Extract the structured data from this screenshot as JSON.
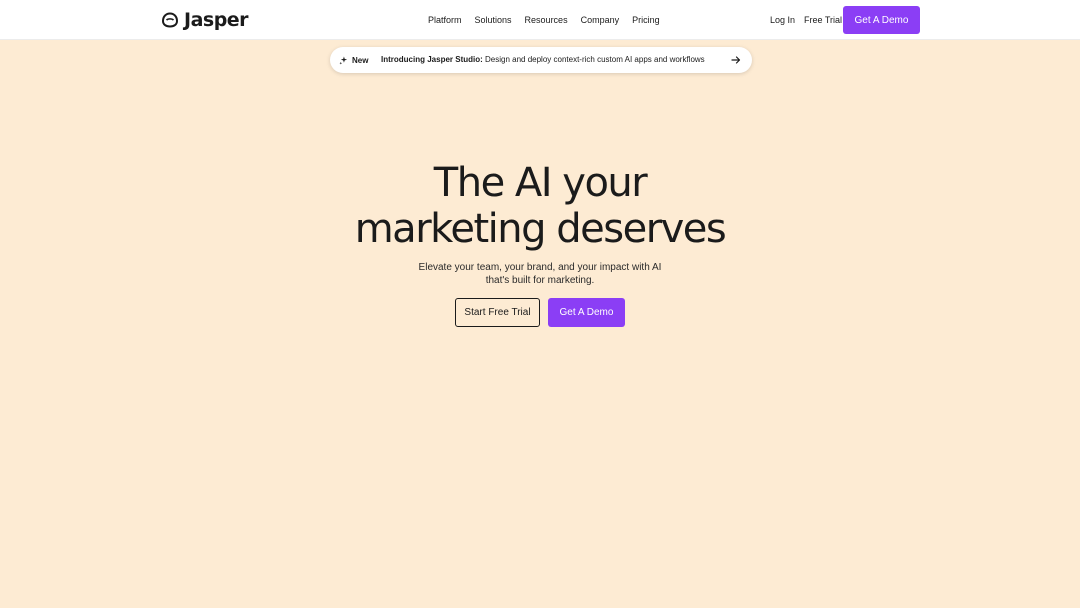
{
  "header": {
    "logo_text": "Jasper",
    "nav": [
      "Platform",
      "Solutions",
      "Resources",
      "Company",
      "Pricing"
    ],
    "login_label": "Log In",
    "free_trial_label": "Free Trial",
    "demo_label": "Get A Demo"
  },
  "announcement": {
    "badge": "New",
    "title": "Introducing Jasper Studio:",
    "text": "Design and deploy context-rich custom AI apps and workflows"
  },
  "hero": {
    "title_line1": "The AI your",
    "title_line2": "marketing deserves",
    "subtitle_line1": "Elevate your team, your brand, and your impact with AI",
    "subtitle_line2": "that's built for marketing.",
    "trial_label": "Start Free Trial",
    "demo_label": "Get A Demo"
  },
  "colors": {
    "background": "#fdebd3",
    "accent": "#8b3ef5",
    "header_bg": "#ffffff"
  },
  "icons": {
    "logo": "jasper-logo-icon",
    "badge": "sparkle-icon",
    "announcement_arrow": "arrow-right-icon"
  }
}
